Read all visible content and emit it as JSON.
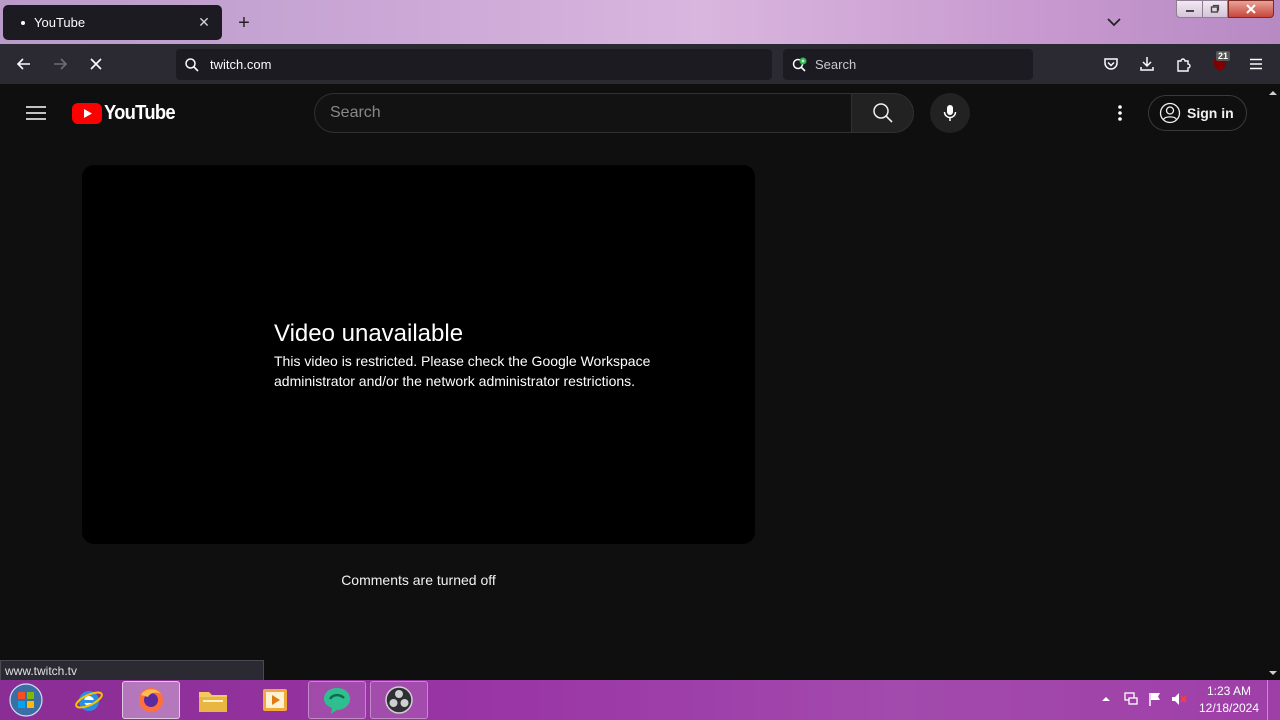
{
  "browser": {
    "tab": {
      "title": "YouTube",
      "close_glyph": "✕"
    },
    "new_tab_glyph": "+",
    "address": {
      "value": "twitch.com"
    },
    "search": {
      "placeholder": "Search"
    },
    "extensions_badge": "21",
    "status_link": "www.twitch.tv"
  },
  "youtube": {
    "logo_text": "YouTube",
    "search_placeholder": "Search",
    "sign_in_label": "Sign in",
    "error": {
      "title": "Video unavailable",
      "message": "This video is restricted. Please check the Google Workspace administrator and/or the network administrator restrictions."
    },
    "comments_status": "Comments are turned off",
    "brand_color": "#ff0000"
  },
  "taskbar": {
    "apps": [
      "internet-explorer",
      "firefox",
      "file-explorer",
      "media-player",
      "chat-app",
      "obs-studio"
    ],
    "active_app": "firefox",
    "clock": {
      "time": "1:23 AM",
      "date": "12/18/2024"
    }
  }
}
